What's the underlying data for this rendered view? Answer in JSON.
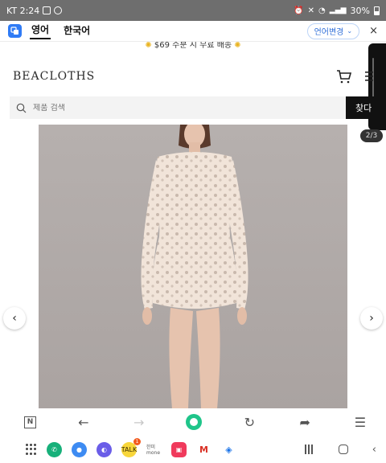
{
  "status_bar": {
    "carrier_time": "KT 2:24",
    "battery": "30%"
  },
  "translate_bar": {
    "language_source": "영어",
    "language_target": "한국어",
    "change_language": "언어변경",
    "close": "×"
  },
  "promo": {
    "text": "$69 수분 시 무료 배송"
  },
  "header": {
    "logo": "BEACLOTHS"
  },
  "search": {
    "placeholder": "제품 검색",
    "button": "찾다"
  },
  "gallery": {
    "pager": "2/3",
    "prev": "‹",
    "next": "›"
  },
  "browser_toolbar": {
    "tab_label": "N"
  },
  "dock": {
    "talk_badge": "1",
    "mone_label": "한미 mone"
  },
  "colors": {
    "status_bar": "#6e6e6e",
    "translate_accent": "#2f7bf5",
    "search_button": "#111111",
    "home_button": "#1fc58a",
    "photo_background": "#b4aead",
    "dress": "#f1e4d9"
  }
}
